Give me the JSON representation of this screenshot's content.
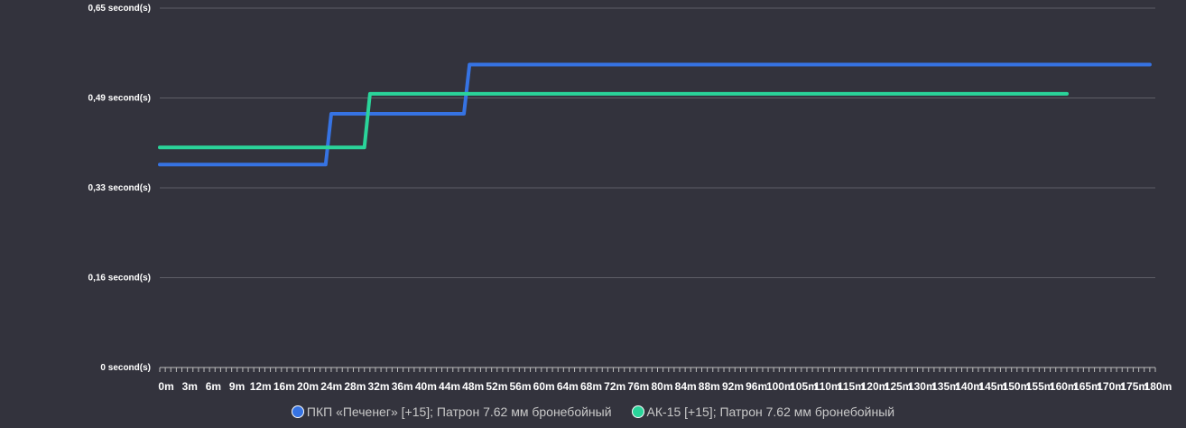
{
  "chart_data": {
    "type": "line",
    "y_ticks": [
      "0 second(s)",
      "0,16 second(s)",
      "0,33 second(s)",
      "0,49 second(s)",
      "0,65 second(s)"
    ],
    "y_tick_values": [
      0,
      0.1625,
      0.325,
      0.4875,
      0.65
    ],
    "ylim": [
      0,
      0.65
    ],
    "x_ticks": [
      "0m",
      "3m",
      "6m",
      "9m",
      "12m",
      "16m",
      "20m",
      "24m",
      "28m",
      "32m",
      "36m",
      "40m",
      "44m",
      "48m",
      "52m",
      "56m",
      "60m",
      "64m",
      "68m",
      "72m",
      "76m",
      "80m",
      "84m",
      "88m",
      "92m",
      "96m",
      "100m",
      "105m",
      "110m",
      "115m",
      "120m",
      "125m",
      "130m",
      "135m",
      "140m",
      "145m",
      "150m",
      "155m",
      "160m",
      "165m",
      "170m",
      "175m",
      "180m"
    ],
    "x_tick_values": [
      0,
      3,
      6,
      9,
      12,
      16,
      20,
      24,
      28,
      32,
      36,
      40,
      44,
      48,
      52,
      56,
      60,
      64,
      68,
      72,
      76,
      80,
      84,
      88,
      92,
      96,
      100,
      105,
      110,
      115,
      120,
      125,
      130,
      135,
      140,
      145,
      150,
      155,
      160,
      165,
      170,
      175,
      180
    ],
    "xlim": [
      0,
      180
    ],
    "grid": true,
    "legend_position": "bottom",
    "series": [
      {
        "name": "ПКП «Печенег» [+15]; Патрон 7.62 мм бронебойный",
        "color": "#3673e3",
        "points": [
          [
            0,
            0.367
          ],
          [
            30,
            0.367
          ],
          [
            31,
            0.459
          ],
          [
            55,
            0.459
          ],
          [
            56,
            0.548
          ],
          [
            179,
            0.548
          ]
        ]
      },
      {
        "name": "АК-15 [+15]; Патрон 7.62 мм бронебойный",
        "color": "#2ad49a",
        "points": [
          [
            0,
            0.398
          ],
          [
            37,
            0.398
          ],
          [
            38,
            0.495
          ],
          [
            164,
            0.495
          ]
        ]
      }
    ]
  }
}
